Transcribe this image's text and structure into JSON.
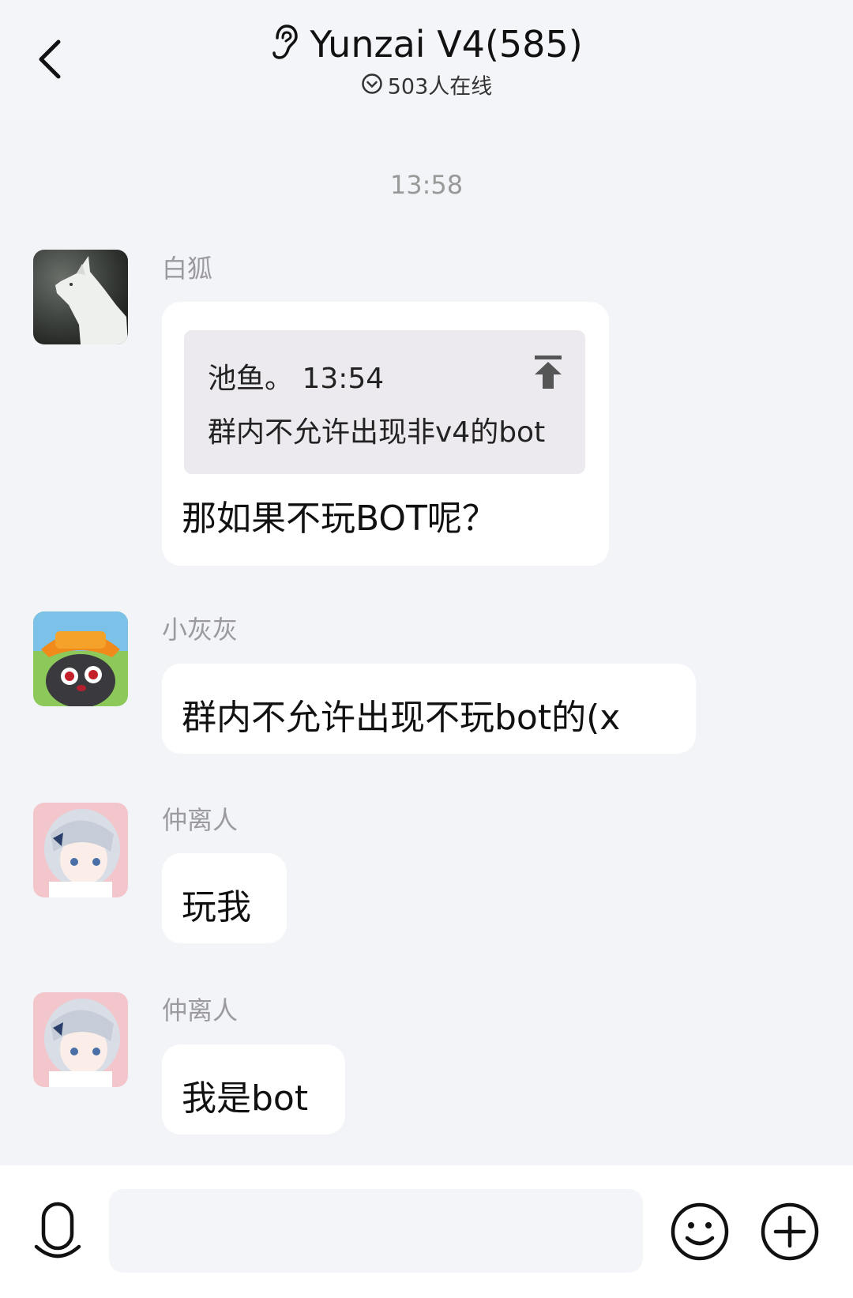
{
  "header": {
    "title": "Yunzai V4(585)",
    "online": "503人在线"
  },
  "time_separator": "13:58",
  "messages": [
    {
      "sender": "白狐",
      "quote": {
        "author_time": "池鱼。 13:54",
        "text": "群内不允许出现非v4的bot"
      },
      "text": "那如果不玩BOT呢？"
    },
    {
      "sender": "小灰灰",
      "text": "群内不允许出现不玩bot的(x"
    },
    {
      "sender": "仲离人",
      "text": "玩我"
    },
    {
      "sender": "仲离人",
      "text": "我是bot"
    }
  ],
  "input": {
    "placeholder": ""
  },
  "icons": {
    "back": "chevron-left-icon",
    "ear": "ear-icon",
    "online": "check-circle-icon",
    "quote": "arrow-up-to-top-icon",
    "mic": "microphone-icon",
    "emoji": "smiley-icon",
    "plus": "plus-circle-icon"
  },
  "colors": {
    "background": "#f3f4f8",
    "bubble": "#ffffff",
    "quote_bg": "#eceaee",
    "meta_text": "#9a9aa0"
  }
}
